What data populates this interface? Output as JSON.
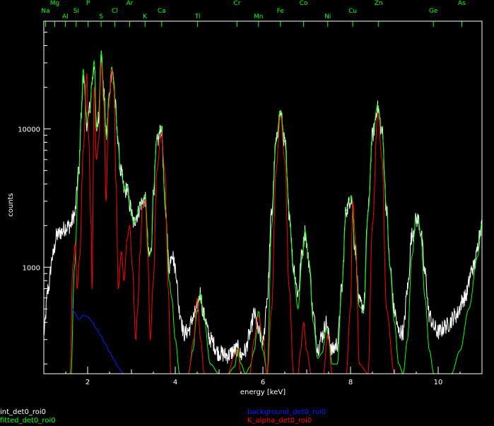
{
  "chart_data": {
    "type": "line",
    "title": "",
    "xlabel": "energy [keV]",
    "ylabel": "counts",
    "xlim": [
      1.0,
      11.0
    ],
    "ylim": [
      170,
      60000
    ],
    "yscale": "log",
    "grid": false,
    "background": "#000000",
    "axis_color": "#ffffff",
    "x_ticks": [
      2,
      4,
      6,
      8,
      10
    ],
    "y_ticks": [
      {
        "value": 1000,
        "label": "1000"
      },
      {
        "value": 10000,
        "label": "10000"
      }
    ],
    "element_markers": {
      "color": "#00ff00",
      "items": [
        {
          "label": "Na",
          "energy": 1.04,
          "row": 2
        },
        {
          "label": "Mg",
          "energy": 1.25,
          "row": 1
        },
        {
          "label": "Al",
          "energy": 1.49,
          "row": 3
        },
        {
          "label": "Si",
          "energy": 1.74,
          "row": 2
        },
        {
          "label": "P",
          "energy": 2.01,
          "row": 1
        },
        {
          "label": "S",
          "energy": 2.31,
          "row": 3
        },
        {
          "label": "Cl",
          "energy": 2.62,
          "row": 2
        },
        {
          "label": "Ar",
          "energy": 2.96,
          "row": 1
        },
        {
          "label": "K",
          "energy": 3.31,
          "row": 3
        },
        {
          "label": "Ca",
          "energy": 3.69,
          "row": 2
        },
        {
          "label": "Ti",
          "energy": 4.51,
          "row": 3
        },
        {
          "label": "Cr",
          "energy": 5.41,
          "row": 1
        },
        {
          "label": "Mn",
          "energy": 5.9,
          "row": 3
        },
        {
          "label": "Fe",
          "energy": 6.4,
          "row": 2
        },
        {
          "label": "Co",
          "energy": 6.93,
          "row": 1
        },
        {
          "label": "Ni",
          "energy": 7.48,
          "row": 3
        },
        {
          "label": "Cu",
          "energy": 8.05,
          "row": 2
        },
        {
          "label": "Zn",
          "energy": 8.64,
          "row": 1
        },
        {
          "label": "Ge",
          "energy": 9.89,
          "row": 2
        },
        {
          "label": "As",
          "energy": 10.54,
          "row": 1
        }
      ]
    },
    "series": [
      {
        "name": "int_det0_roi0",
        "color": "#ffffff",
        "style": "noisy",
        "noise": 0.06,
        "x": [
          1.0,
          1.1,
          1.2,
          1.3,
          1.4,
          1.5,
          1.6,
          1.7,
          1.8,
          1.85,
          1.9,
          1.98,
          2.05,
          2.1,
          2.15,
          2.2,
          2.25,
          2.31,
          2.37,
          2.43,
          2.49,
          2.55,
          2.6,
          2.63,
          2.68,
          2.75,
          2.85,
          2.9,
          2.96,
          3.05,
          3.13,
          3.22,
          3.31,
          3.4,
          3.45,
          3.5,
          3.58,
          3.68,
          3.78,
          3.86,
          3.92,
          4.0,
          4.1,
          4.2,
          4.3,
          4.4,
          4.5,
          4.57,
          4.65,
          4.8,
          5.0,
          5.2,
          5.35,
          5.43,
          5.5,
          5.6,
          5.7,
          5.8,
          5.9,
          6.0,
          6.1,
          6.2,
          6.3,
          6.4,
          6.5,
          6.6,
          6.7,
          6.8,
          6.9,
          6.96,
          7.05,
          7.15,
          7.25,
          7.35,
          7.45,
          7.5,
          7.58,
          7.7,
          7.8,
          7.9,
          8.02,
          8.1,
          8.2,
          8.3,
          8.4,
          8.5,
          8.62,
          8.72,
          8.82,
          8.9,
          9.0,
          9.1,
          9.2,
          9.3,
          9.4,
          9.5,
          9.55,
          9.6,
          9.7,
          9.8,
          9.9,
          10.0,
          10.2,
          10.4,
          10.6,
          10.8,
          11.0
        ],
        "y": [
          340,
          700,
          1200,
          1700,
          1800,
          1950,
          2000,
          2400,
          5000,
          12000,
          25000,
          11000,
          14000,
          22000,
          30000,
          10000,
          12000,
          34000,
          18000,
          9000,
          17000,
          27000,
          22000,
          15000,
          9000,
          5000,
          3500,
          3800,
          2800,
          2100,
          2400,
          2900,
          3100,
          1200,
          1300,
          3500,
          8000,
          10000,
          2500,
          1000,
          1300,
          1000,
          480,
          330,
          350,
          430,
          500,
          650,
          450,
          300,
          240,
          230,
          250,
          260,
          230,
          250,
          330,
          460,
          340,
          280,
          600,
          2500,
          8000,
          13000,
          8000,
          2500,
          1000,
          650,
          1300,
          1800,
          1100,
          450,
          260,
          320,
          400,
          320,
          250,
          280,
          700,
          2600,
          3200,
          1400,
          550,
          520,
          2500,
          9000,
          14000,
          9500,
          2700,
          1000,
          480,
          340,
          340,
          700,
          1700,
          2200,
          2200,
          1800,
          900,
          450,
          370,
          340,
          380,
          450,
          600,
          1000,
          2000
        ]
      },
      {
        "name": "fitted_det0_roi0",
        "color": "#00ff00",
        "style": "smooth",
        "x": [
          1.62,
          1.7,
          1.8,
          1.85,
          1.9,
          1.98,
          2.05,
          2.1,
          2.15,
          2.2,
          2.25,
          2.31,
          2.37,
          2.43,
          2.49,
          2.55,
          2.6,
          2.63,
          2.68,
          2.75,
          2.85,
          2.9,
          2.96,
          3.05,
          3.13,
          3.22,
          3.31,
          3.4,
          3.45,
          3.5,
          3.58,
          3.68,
          3.78,
          3.86,
          3.92,
          4.0,
          4.1,
          4.2,
          4.3,
          4.4,
          4.5,
          4.57,
          4.65,
          4.8,
          5.0,
          5.2,
          5.35,
          5.43,
          5.5,
          5.6,
          5.7,
          5.8,
          5.9,
          6.0,
          6.1,
          6.2,
          6.3,
          6.4,
          6.5,
          6.6,
          6.7,
          6.8,
          6.9,
          6.96,
          7.05,
          7.15,
          7.25,
          7.35,
          7.45,
          7.5,
          7.58,
          7.7,
          7.8,
          7.9,
          8.02,
          8.1,
          8.2,
          8.3,
          8.4,
          8.5,
          8.62,
          8.72,
          8.82,
          8.9,
          9.0,
          9.1,
          9.2,
          9.3,
          9.4,
          9.5,
          9.55,
          9.6,
          9.7,
          9.8,
          9.9,
          10.0,
          10.1,
          10.3,
          10.5,
          10.7,
          10.9,
          11.0
        ],
        "y": [
          170,
          1000,
          5000,
          12000,
          27000,
          11000,
          13500,
          22000,
          31000,
          10000,
          12500,
          36000,
          18000,
          8500,
          17000,
          28000,
          22000,
          15000,
          9000,
          5000,
          3600,
          3900,
          2800,
          2100,
          2400,
          2900,
          3300,
          1200,
          1300,
          3500,
          8500,
          10500,
          2500,
          800,
          600,
          300,
          170,
          170,
          170,
          250,
          480,
          650,
          450,
          200,
          170,
          170,
          190,
          260,
          200,
          170,
          190,
          250,
          480,
          250,
          170,
          2000,
          8000,
          13500,
          8000,
          2500,
          900,
          500,
          1200,
          1850,
          1100,
          400,
          220,
          240,
          360,
          300,
          200,
          200,
          700,
          2600,
          3300,
          1400,
          520,
          480,
          2500,
          9000,
          15000,
          9500,
          2700,
          1000,
          400,
          200,
          170,
          300,
          1200,
          2300,
          2200,
          1700,
          600,
          250,
          170,
          170,
          170,
          170,
          250,
          500,
          1200,
          2100
        ]
      },
      {
        "name": "background_det0_roi0",
        "color": "#0020ff",
        "style": "smooth",
        "x": [
          1.63,
          1.7,
          1.8,
          1.9,
          2.0,
          2.1,
          2.2,
          2.3,
          2.4,
          2.5,
          2.6,
          2.7,
          2.75,
          2.8,
          2.83,
          4.0,
          6.0,
          9.0,
          11.0
        ],
        "y": [
          520,
          470,
          420,
          450,
          440,
          405,
          360,
          320,
          280,
          245,
          215,
          190,
          180,
          172,
          170,
          170,
          170,
          170,
          170
        ]
      },
      {
        "name": "K_alpha_det0_roi0",
        "color": "#ff0000",
        "style": "smooth",
        "x": [
          1.6,
          1.66,
          1.72,
          1.76,
          1.82,
          1.9,
          1.98,
          2.02,
          2.08,
          2.1,
          2.15,
          2.2,
          2.25,
          2.31,
          2.37,
          2.42,
          2.48,
          2.55,
          2.6,
          2.65,
          2.7,
          2.77,
          2.83,
          2.9,
          2.96,
          3.02,
          3.1,
          3.14,
          3.2,
          3.25,
          3.31,
          3.37,
          3.43,
          3.5,
          3.58,
          3.68,
          3.76,
          3.84,
          3.9,
          4.3,
          4.42,
          4.5,
          4.58,
          4.66,
          4.8,
          5.2,
          5.35,
          5.42,
          5.5,
          5.7,
          5.8,
          5.9,
          6.0,
          6.1,
          6.2,
          6.3,
          6.4,
          6.5,
          6.6,
          6.7,
          6.8,
          6.86,
          6.93,
          7.0,
          7.1,
          7.38,
          7.48,
          7.58,
          7.9,
          8.0,
          8.05,
          8.12,
          8.2,
          8.4,
          8.5,
          8.62,
          8.72,
          8.82,
          9.0,
          11.0
        ],
        "y": [
          170,
          1000,
          1500,
          700,
          1200,
          7000,
          25000,
          9000,
          2000,
          700,
          20000,
          6000,
          8000,
          30000,
          15000,
          3000,
          14000,
          27000,
          19000,
          4000,
          700,
          1300,
          800,
          1600,
          2000,
          1000,
          300,
          500,
          1300,
          2700,
          3100,
          1300,
          300,
          800,
          5000,
          9500,
          5000,
          700,
          170,
          170,
          300,
          600,
          300,
          170,
          170,
          170,
          230,
          260,
          170,
          170,
          300,
          450,
          300,
          170,
          500,
          5000,
          12500,
          6000,
          700,
          170,
          170,
          250,
          400,
          250,
          170,
          170,
          330,
          170,
          170,
          500,
          3000,
          1500,
          200,
          170,
          2000,
          13000,
          6000,
          500,
          170,
          170
        ]
      }
    ]
  }
}
